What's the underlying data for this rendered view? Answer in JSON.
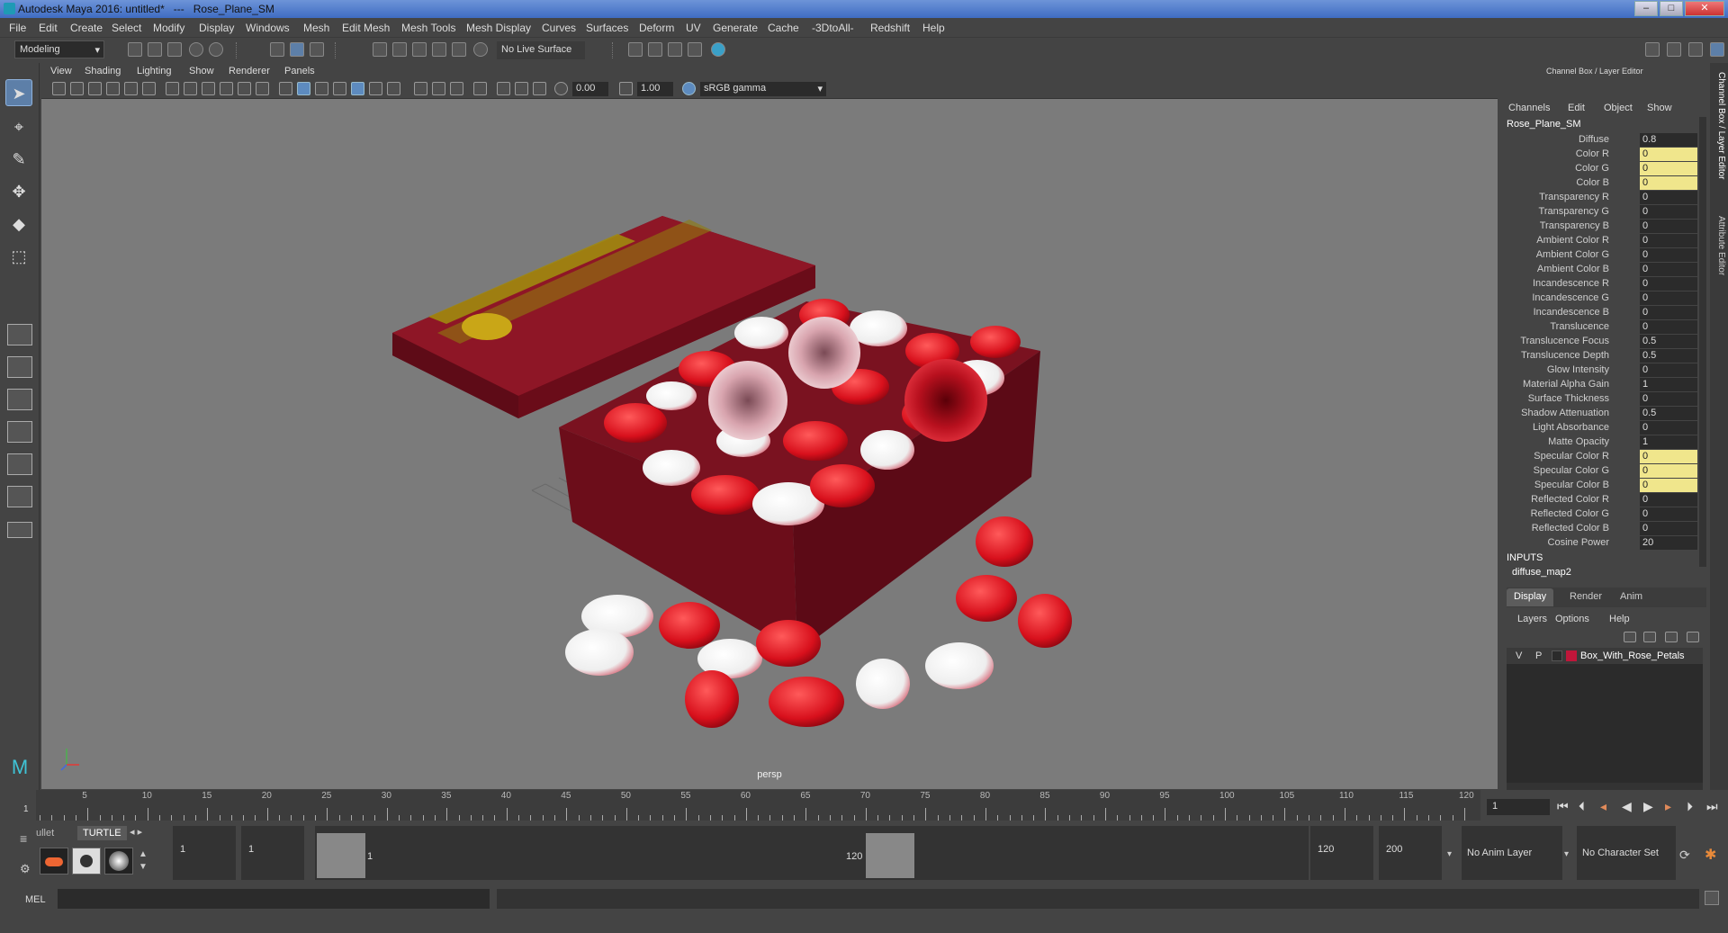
{
  "window": {
    "title": "Autodesk Maya 2016: untitled*   ---   Rose_Plane_SM",
    "min": "–",
    "max": "□",
    "close": "✕"
  },
  "menus": [
    "File",
    "Edit",
    "Create",
    "Select",
    "Modify",
    "Display",
    "Windows",
    "Mesh",
    "Edit Mesh",
    "Mesh Tools",
    "Mesh Display",
    "Curves",
    "Surfaces",
    "Deform",
    "UV",
    "Generate",
    "Cache",
    "-3DtoAll-",
    "Redshift",
    "Help"
  ],
  "status": {
    "mode": "Modeling",
    "live_surface": "No Live Surface"
  },
  "panel_menu": [
    "View",
    "Shading",
    "Lighting",
    "Show",
    "Renderer",
    "Panels"
  ],
  "panel_fields": {
    "exposure": "0.00",
    "gamma": "1.00",
    "colorspace": "sRGB gamma"
  },
  "viewport": {
    "camera": "persp"
  },
  "channel_box": {
    "header": "Channel Box / Layer Editor",
    "menu": [
      "Channels",
      "Edit",
      "Object",
      "Show"
    ],
    "object": "Rose_Plane_SM",
    "attributes": [
      {
        "name": "Diffuse",
        "value": "0.8",
        "keyed": false
      },
      {
        "name": "Color R",
        "value": "0",
        "keyed": true
      },
      {
        "name": "Color G",
        "value": "0",
        "keyed": true
      },
      {
        "name": "Color B",
        "value": "0",
        "keyed": true
      },
      {
        "name": "Transparency R",
        "value": "0",
        "keyed": false
      },
      {
        "name": "Transparency G",
        "value": "0",
        "keyed": false
      },
      {
        "name": "Transparency B",
        "value": "0",
        "keyed": false
      },
      {
        "name": "Ambient Color R",
        "value": "0",
        "keyed": false
      },
      {
        "name": "Ambient Color G",
        "value": "0",
        "keyed": false
      },
      {
        "name": "Ambient Color B",
        "value": "0",
        "keyed": false
      },
      {
        "name": "Incandescence R",
        "value": "0",
        "keyed": false
      },
      {
        "name": "Incandescence G",
        "value": "0",
        "keyed": false
      },
      {
        "name": "Incandescence B",
        "value": "0",
        "keyed": false
      },
      {
        "name": "Translucence",
        "value": "0",
        "keyed": false
      },
      {
        "name": "Translucence Focus",
        "value": "0.5",
        "keyed": false
      },
      {
        "name": "Translucence Depth",
        "value": "0.5",
        "keyed": false
      },
      {
        "name": "Glow Intensity",
        "value": "0",
        "keyed": false
      },
      {
        "name": "Material Alpha Gain",
        "value": "1",
        "keyed": false
      },
      {
        "name": "Surface Thickness",
        "value": "0",
        "keyed": false
      },
      {
        "name": "Shadow Attenuation",
        "value": "0.5",
        "keyed": false
      },
      {
        "name": "Light Absorbance",
        "value": "0",
        "keyed": false
      },
      {
        "name": "Matte Opacity",
        "value": "1",
        "keyed": false
      },
      {
        "name": "Specular Color R",
        "value": "0",
        "keyed": true
      },
      {
        "name": "Specular Color G",
        "value": "0",
        "keyed": true
      },
      {
        "name": "Specular Color B",
        "value": "0",
        "keyed": true
      },
      {
        "name": "Reflected Color R",
        "value": "0",
        "keyed": false
      },
      {
        "name": "Reflected Color G",
        "value": "0",
        "keyed": false
      },
      {
        "name": "Reflected Color B",
        "value": "0",
        "keyed": false
      },
      {
        "name": "Cosine Power",
        "value": "20",
        "keyed": false
      }
    ],
    "inputs_label": "INPUTS",
    "input_node": "diffuse_map2"
  },
  "side_tabs": [
    "Channel Box / Layer Editor",
    "Attribute Editor"
  ],
  "layer_editor": {
    "tabs": [
      "Display",
      "Render",
      "Anim"
    ],
    "menu": [
      "Layers",
      "Options",
      "Help"
    ],
    "layer": {
      "v": "V",
      "p": "P",
      "name": "Box_With_Rose_Petals",
      "color": "#c0163a"
    }
  },
  "timeline": {
    "ticks": [
      "5",
      "10",
      "15",
      "20",
      "25",
      "30",
      "35",
      "40",
      "45",
      "50",
      "55",
      "60",
      "65",
      "70",
      "75",
      "80",
      "85",
      "90",
      "95",
      "100",
      "105",
      "110",
      "115",
      "120"
    ],
    "start_label": "1",
    "current_frame": "1"
  },
  "range": {
    "shelf_tabs": [
      "ullet",
      "TURTLE"
    ],
    "start": "1",
    "anim_start": "1",
    "slider_start": "1",
    "slider_end": "120",
    "anim_end": "120",
    "end": "200",
    "anim_layer": "No Anim Layer",
    "char_set": "No Character Set"
  },
  "command": {
    "lang": "MEL"
  }
}
